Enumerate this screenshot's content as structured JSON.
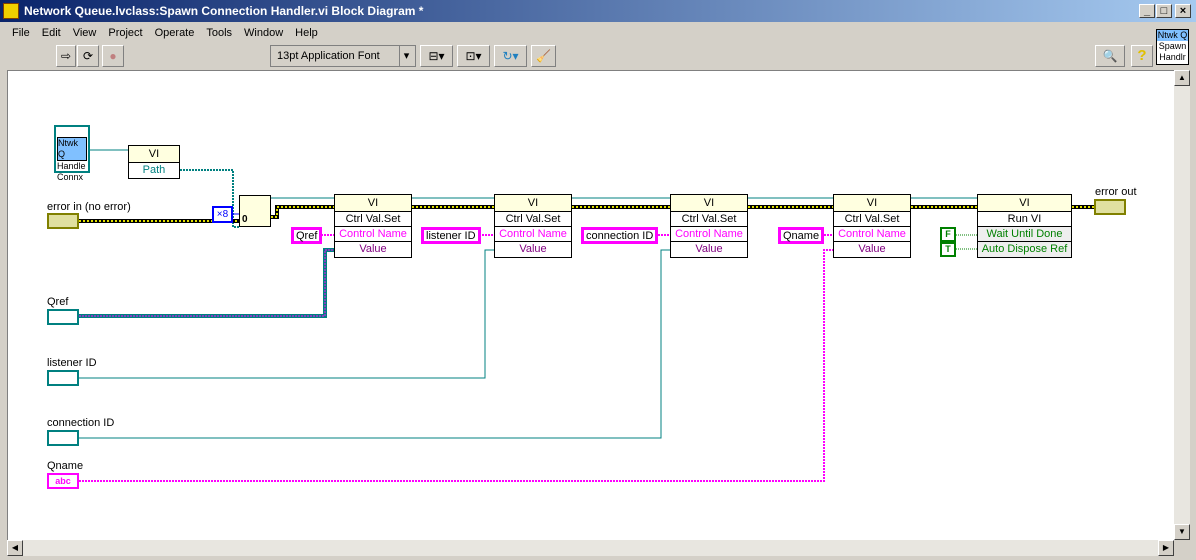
{
  "window": {
    "title": "Network Queue.lvclass:Spawn Connection Handler.vi Block Diagram *",
    "minimize": "_",
    "maximize": "□",
    "close": "×"
  },
  "menu": [
    "File",
    "Edit",
    "View",
    "Project",
    "Operate",
    "Tools",
    "Window",
    "Help"
  ],
  "toolbar": {
    "run": "⇨",
    "run_continuous": "⟳",
    "abort": "●",
    "font": "13pt Application Font",
    "dropdown": "▾",
    "align": "⊟▾",
    "distribute": "⊡▾",
    "reorder": "↻▾",
    "cleanup": "🧹",
    "search": "🔍",
    "help": "?"
  },
  "connector_icon": [
    "Ntwk Q",
    "Spawn",
    "Handlr"
  ],
  "diagram": {
    "static_ref": [
      "Ntwk Q",
      "Handle",
      "Connx"
    ],
    "open_node": {
      "header": "VI",
      "row": "Path"
    },
    "x8": "×8",
    "zero": "0",
    "controls": [
      {
        "label": "error in (no error)"
      },
      {
        "label": "Qref"
      },
      {
        "label": "listener ID"
      },
      {
        "label": "connection ID"
      },
      {
        "label": "Qname",
        "glyph": "abc"
      }
    ],
    "error_out": "error out",
    "invoke_nodes": [
      {
        "header": "VI",
        "method": "Ctrl Val.Set",
        "in1": "Control Name",
        "in2": "Value",
        "const": "Qref"
      },
      {
        "header": "VI",
        "method": "Ctrl Val.Set",
        "in1": "Control Name",
        "in2": "Value",
        "const": "listener ID"
      },
      {
        "header": "VI",
        "method": "Ctrl Val.Set",
        "in1": "Control Name",
        "in2": "Value",
        "const": "connection ID"
      },
      {
        "header": "VI",
        "method": "Ctrl Val.Set",
        "in1": "Control Name",
        "in2": "Value",
        "const": "Qname"
      }
    ],
    "run_node": {
      "header": "VI",
      "method": "Run VI",
      "in1": "Wait Until Done",
      "in2": "Auto Dispose Ref",
      "c1": "F",
      "c2": "T"
    }
  },
  "colors": {
    "refwire": "#008080",
    "string": "#ff00ff",
    "error": "#c8c800",
    "boolean": "#008000"
  }
}
